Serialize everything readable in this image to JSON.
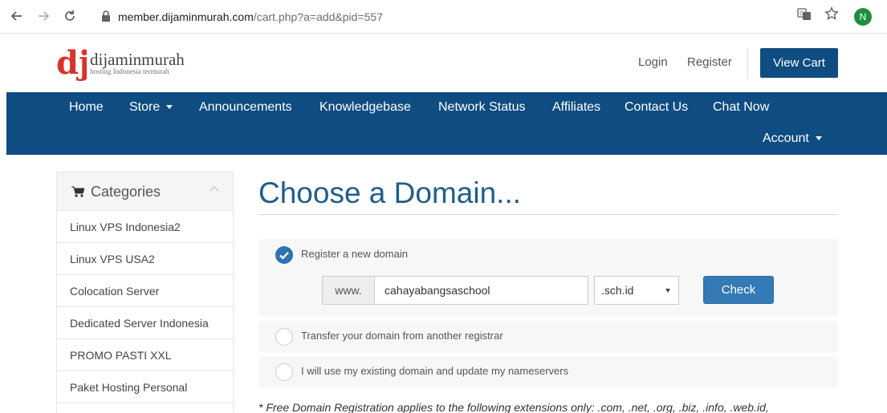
{
  "browser": {
    "url_host": "member.dijaminmurah.com",
    "url_path": "/cart.php?a=add&pid=557",
    "profile_initial": "N",
    "icons": [
      "back-arrow-icon",
      "forward-arrow-icon",
      "reload-icon",
      "lock-icon",
      "translate-icon",
      "star-icon"
    ]
  },
  "site": {
    "logo_letters": "dj",
    "logo_name": "dijaminmurah",
    "logo_tagline": "hosting Indonesia termurah",
    "login_label": "Login",
    "register_label": "Register",
    "view_cart_label": "View Cart"
  },
  "nav": {
    "items": [
      "Home",
      "Store",
      "Announcements",
      "Knowledgebase",
      "Network Status",
      "Affiliates",
      "Contact Us",
      "Chat Now"
    ],
    "account_label": "Account"
  },
  "sidebar": {
    "title": "Categories",
    "items": [
      "Linux VPS Indonesia2",
      "Linux VPS USA2",
      "Colocation Server",
      "Dedicated Server Indonesia",
      "PROMO PASTI XXL",
      "Paket Hosting Personal"
    ]
  },
  "content": {
    "title": "Choose a Domain...",
    "option_register": "Register a new domain",
    "www_prefix": "www.",
    "domain_value": "cahayabangsaschool",
    "tld_selected": ".sch.id",
    "check_label": "Check",
    "option_transfer": "Transfer your domain from another registrar",
    "option_existing": "I will use my existing domain and update my nameservers",
    "footnote": "* Free Domain Registration applies to the following extensions only: .com, .net, .org, .biz, .info, .web.id,"
  },
  "colors": {
    "brand_blue": "#0f4c81",
    "button_blue": "#337ab7",
    "logo_red": "#d9322b"
  }
}
